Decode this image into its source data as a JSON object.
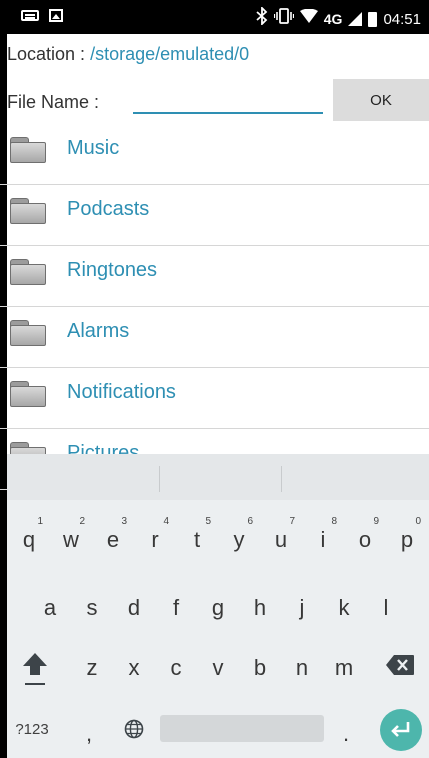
{
  "status_bar": {
    "time": "04:51",
    "network": "4G",
    "icons": [
      "keyboard-icon",
      "image-icon",
      "bluetooth-icon",
      "vibrate-icon",
      "wifi-icon",
      "signal-icon",
      "battery-icon"
    ]
  },
  "location": {
    "label": "Location : ",
    "path": "/storage/emulated/0"
  },
  "file_name": {
    "label": "File Name :",
    "value": "",
    "placeholder": ""
  },
  "ok_button": "OK",
  "folders": [
    "Music",
    "Podcasts",
    "Ringtones",
    "Alarms",
    "Notifications",
    "Pictures"
  ],
  "keyboard": {
    "row1": [
      {
        "k": "q",
        "h": "1"
      },
      {
        "k": "w",
        "h": "2"
      },
      {
        "k": "e",
        "h": "3"
      },
      {
        "k": "r",
        "h": "4"
      },
      {
        "k": "t",
        "h": "5"
      },
      {
        "k": "y",
        "h": "6"
      },
      {
        "k": "u",
        "h": "7"
      },
      {
        "k": "i",
        "h": "8"
      },
      {
        "k": "o",
        "h": "9"
      },
      {
        "k": "p",
        "h": "0"
      }
    ],
    "row2": [
      "a",
      "s",
      "d",
      "f",
      "g",
      "h",
      "j",
      "k",
      "l"
    ],
    "row3": [
      "z",
      "x",
      "c",
      "v",
      "b",
      "n",
      "m"
    ],
    "symbols_label": "?123",
    "comma": ",",
    "period": "."
  },
  "colors": {
    "accent": "#2e8fb3",
    "enter_key": "#4db6ac",
    "ok_button_bg": "#dcdcdc"
  }
}
